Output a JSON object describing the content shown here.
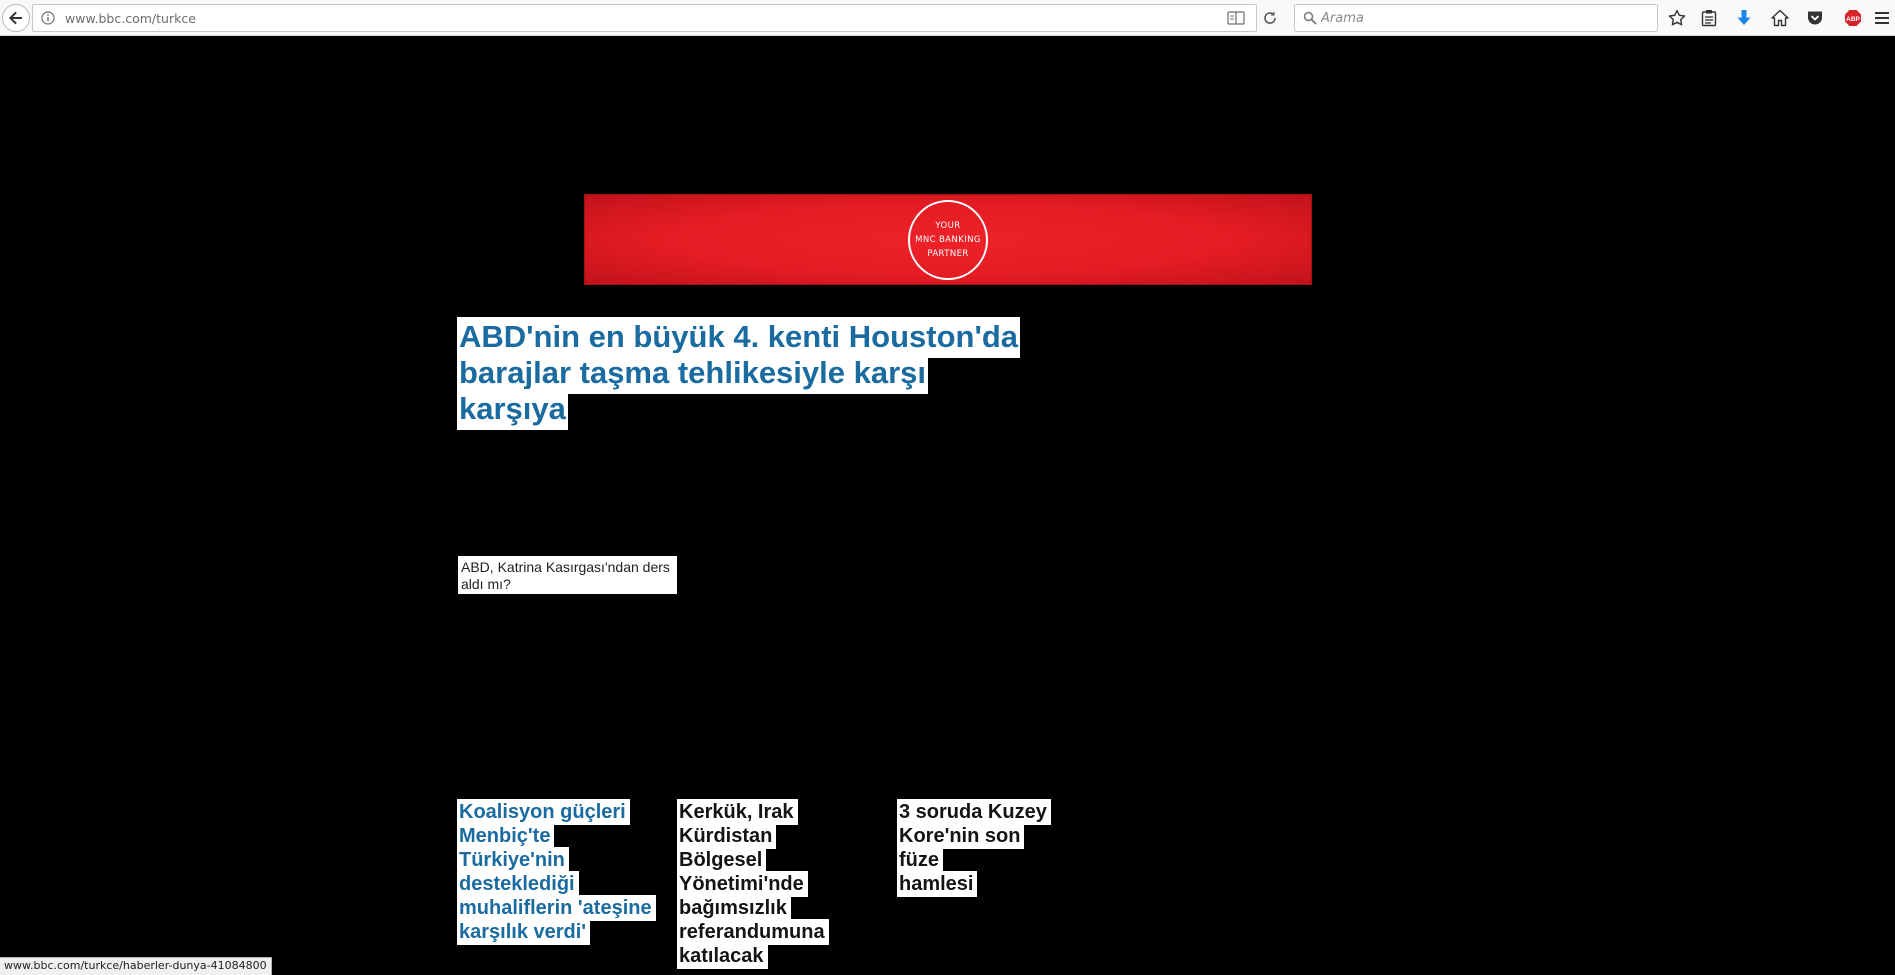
{
  "browser": {
    "url": "www.bbc.com/turkce",
    "search_placeholder": "Arama",
    "status_url": "www.bbc.com/turkce/haberler-dunya-41084800",
    "icons": [
      "back-arrow-icon",
      "info-icon",
      "reader-view-icon",
      "reload-icon",
      "search-icon",
      "bookmark-star-icon",
      "clipboard-icon",
      "download-icon",
      "home-icon",
      "pocket-icon",
      "adblock-plus-icon",
      "hamburger-menu-icon"
    ]
  },
  "ad": {
    "line1": "YOUR",
    "line2": "MNC BANKING",
    "line3": "PARTNER",
    "color": "#e51c23"
  },
  "main_story": {
    "headline_line1": "ABD'nin en büyük 4. kenti Houston'da",
    "headline_line2": "barajlar taşma tehlikesiyle karşı karşıya",
    "caption": "ABD, Katrina Kasırgası'ndan ders aldı mı?"
  },
  "stories": [
    {
      "lines": [
        "Koalisyon güçleri",
        "Menbiç'te Türkiye'nin",
        "desteklediği",
        "muhaliflerin 'ateşine",
        "karşılık verdi'"
      ]
    },
    {
      "lines": [
        "Kerkük, Irak Kürdistan",
        "Bölgesel Yönetimi'nde",
        "bağımsızlık",
        "referandumuna",
        "katılacak"
      ]
    },
    {
      "lines": [
        "3 soruda Kuzey",
        "Kore'nin son füze",
        "hamlesi"
      ]
    }
  ],
  "colors": {
    "link_blue": "#1a6ba0",
    "page_bg": "#000000"
  }
}
